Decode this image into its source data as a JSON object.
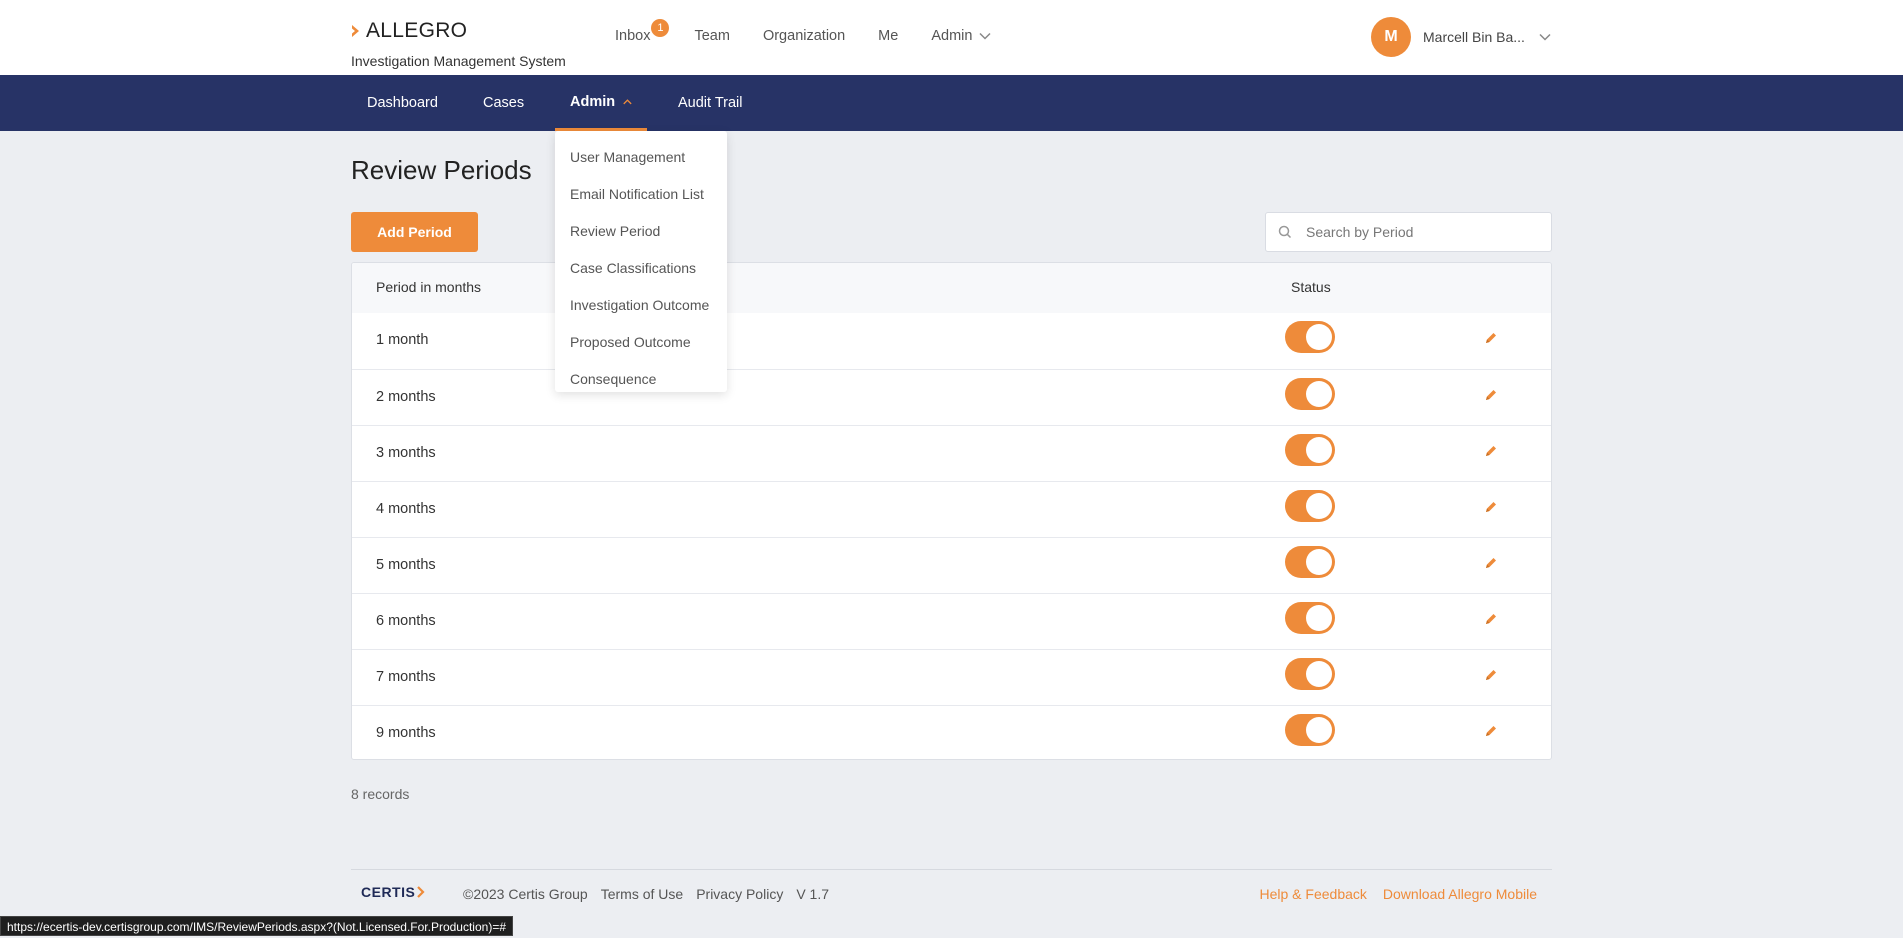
{
  "header": {
    "brand_name": "ALLEGRO",
    "brand_subtitle": "Investigation Management System",
    "nav": [
      {
        "label": "Inbox",
        "badge": "1"
      },
      {
        "label": "Team"
      },
      {
        "label": "Organization"
      },
      {
        "label": "Me"
      },
      {
        "label": "Admin"
      }
    ],
    "user_initial": "M",
    "user_name": "Marcell Bin Ba..."
  },
  "main_nav": {
    "tabs": [
      {
        "label": "Dashboard"
      },
      {
        "label": "Cases"
      },
      {
        "label": "Admin"
      },
      {
        "label": "Audit Trail"
      }
    ]
  },
  "admin_menu": [
    "User Management",
    "Email Notification List",
    "Review Period",
    "Case Classifications",
    "Investigation Outcome",
    "Proposed Outcome",
    "Consequence"
  ],
  "page": {
    "title": "Review Periods",
    "add_button": "Add Period",
    "search_placeholder": "Search by Period"
  },
  "table": {
    "columns": [
      "Period in months",
      "Status"
    ],
    "rows": [
      {
        "period": "1 month",
        "active": true
      },
      {
        "period": "2 months",
        "active": true
      },
      {
        "period": "3 months",
        "active": true
      },
      {
        "period": "4 months",
        "active": true
      },
      {
        "period": "5 months",
        "active": true
      },
      {
        "period": "6 months",
        "active": true
      },
      {
        "period": "7 months",
        "active": true
      },
      {
        "period": "9 months",
        "active": true
      }
    ],
    "records_count": "8 records"
  },
  "footer": {
    "company_logo": "CERTIS",
    "copyright": "©2023 Certis Group",
    "terms": "Terms of Use",
    "privacy": "Privacy Policy",
    "version": "V 1.7",
    "help": "Help & Feedback",
    "download": "Download Allegro Mobile"
  },
  "status_url": "https://ecertis-dev.certisgroup.com/IMS/ReviewPeriods.aspx?(Not.Licensed.For.Production)=#",
  "colors": {
    "accent": "#ee8b3a",
    "navy": "#273366",
    "background": "#eceef2"
  }
}
